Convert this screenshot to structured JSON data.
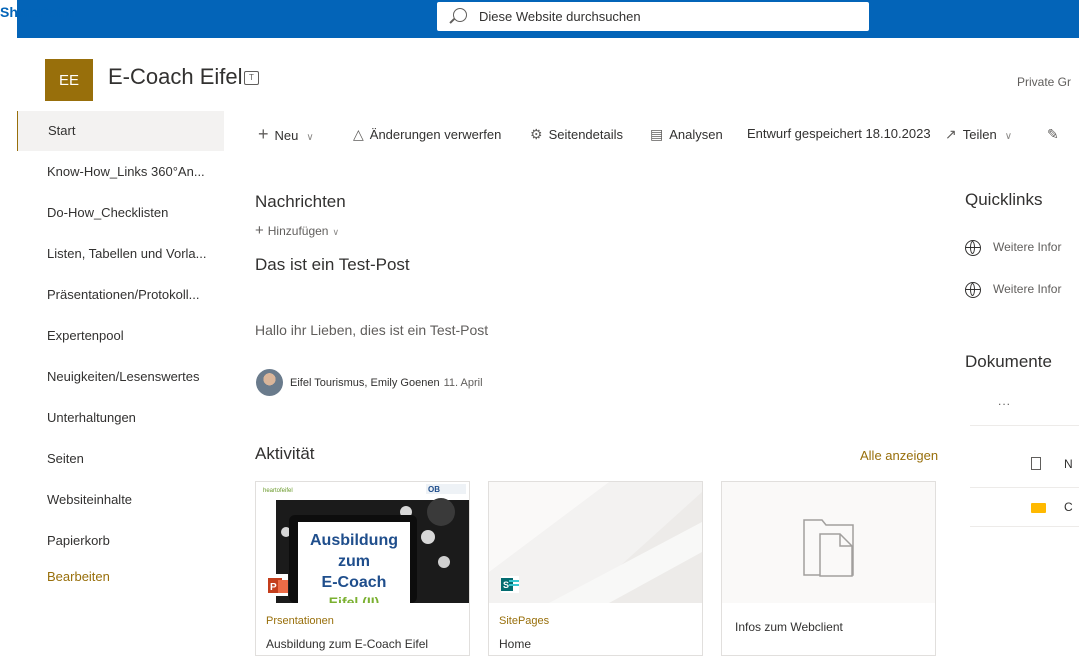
{
  "suitebar": {
    "brand": "SharePoint",
    "search_placeholder": "Diese Website durchsuchen"
  },
  "site": {
    "logo_initials": "EE",
    "title": "E-Coach Eifel",
    "privacy": "Private Gr"
  },
  "nav": {
    "items": [
      "Start",
      "Know-How_Links 360°An...",
      "Do-How_Checklisten",
      "Listen, Tabellen und Vorla...",
      "Präsentationen/Protokoll...",
      "Expertenpool",
      "Neuigkeiten/Lesenswertes",
      "Unterhaltungen",
      "Seiten",
      "Websiteinhalte",
      "Papierkorb",
      "Bearbeiten"
    ]
  },
  "commands": {
    "new": "Neu",
    "discard": "Änderungen verwerfen",
    "details": "Seitendetails",
    "analytics": "Analysen",
    "saved": "Entwurf gespeichert 18.10.2023",
    "share": "Teilen"
  },
  "news": {
    "heading": "Nachrichten",
    "add": "Hinzufügen",
    "post_title": "Das ist ein Test-Post",
    "post_body": "Hallo ihr Lieben, dies ist ein Test-Post",
    "author": "Eifel Tourismus, Emily Goenen",
    "date": "11. April"
  },
  "activity": {
    "heading": "Aktivität",
    "see_all": "Alle anzeigen",
    "cards": [
      {
        "meta": "Prsentationen",
        "title": "Ausbildung zum E-Coach Eifel",
        "thumb_line1": "Ausbildung",
        "thumb_line2": "zum",
        "thumb_line3": "E-Coach",
        "thumb_line4": "Eifel (II)",
        "file_badge": "P",
        "logo_left": "heartofeifel",
        "logo_right": "OB"
      },
      {
        "meta": "SitePages",
        "title": "Home",
        "file_badge": "S"
      },
      {
        "title": "Infos zum Webclient"
      }
    ]
  },
  "quicklinks": {
    "heading": "Quicklinks",
    "items": [
      "Weitere Infor",
      "Weitere Infor"
    ]
  },
  "documents": {
    "heading": "Dokumente",
    "more": "...",
    "items": [
      "N",
      "C"
    ]
  },
  "colors": {
    "suitebar": "#0364b8",
    "accent": "#986f0b"
  }
}
